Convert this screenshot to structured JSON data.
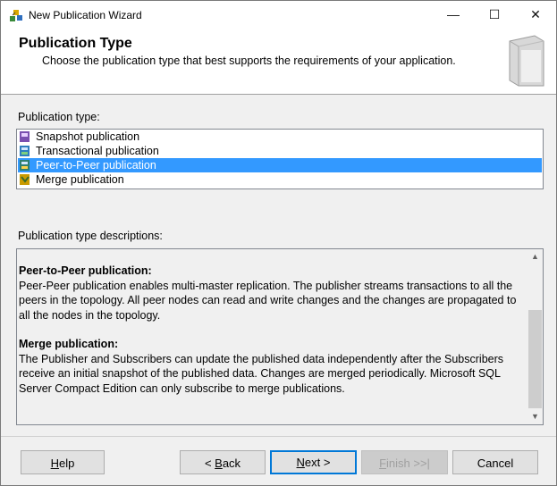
{
  "window": {
    "title": "New Publication Wizard",
    "icon": "wizard-icon",
    "controls": {
      "minimize": "—",
      "maximize": "☐",
      "close": "✕"
    }
  },
  "header": {
    "title": "Publication Type",
    "subtitle": "Choose the publication type that best supports the requirements of your application.",
    "icon": "book-icon"
  },
  "publication_type": {
    "label": "Publication type:",
    "items": [
      {
        "label": "Snapshot publication",
        "icon": "snapshot-icon",
        "selected": false
      },
      {
        "label": "Transactional publication",
        "icon": "transactional-icon",
        "selected": false
      },
      {
        "label": "Peer-to-Peer publication",
        "icon": "peer-to-peer-icon",
        "selected": true
      },
      {
        "label": "Merge publication",
        "icon": "merge-icon",
        "selected": false
      }
    ]
  },
  "descriptions": {
    "label": "Publication type descriptions:",
    "sections": [
      {
        "title": "Peer-to-Peer publication:",
        "text": "Peer-Peer publication enables multi-master replication. The publisher streams transactions to all the peers in the topology. All peer nodes can read and write changes and the changes are propagated to all the nodes in the topology."
      },
      {
        "title": "Merge publication:",
        "text": "The Publisher and Subscribers can update the published data independently after the Subscribers receive an initial snapshot of the published data. Changes are merged periodically. Microsoft SQL Server Compact Edition can only subscribe to merge publications."
      }
    ]
  },
  "buttons": {
    "help": {
      "mnemonic": "H",
      "rest": "elp"
    },
    "back": {
      "prefix": "< ",
      "mnemonic": "B",
      "rest": "ack"
    },
    "next": {
      "mnemonic": "N",
      "rest": "ext >"
    },
    "finish": {
      "mnemonic": "F",
      "rest": "inish >>|"
    },
    "cancel": "Cancel"
  },
  "colors": {
    "selection": "#3399ff",
    "default_button_border": "#0078d7"
  }
}
